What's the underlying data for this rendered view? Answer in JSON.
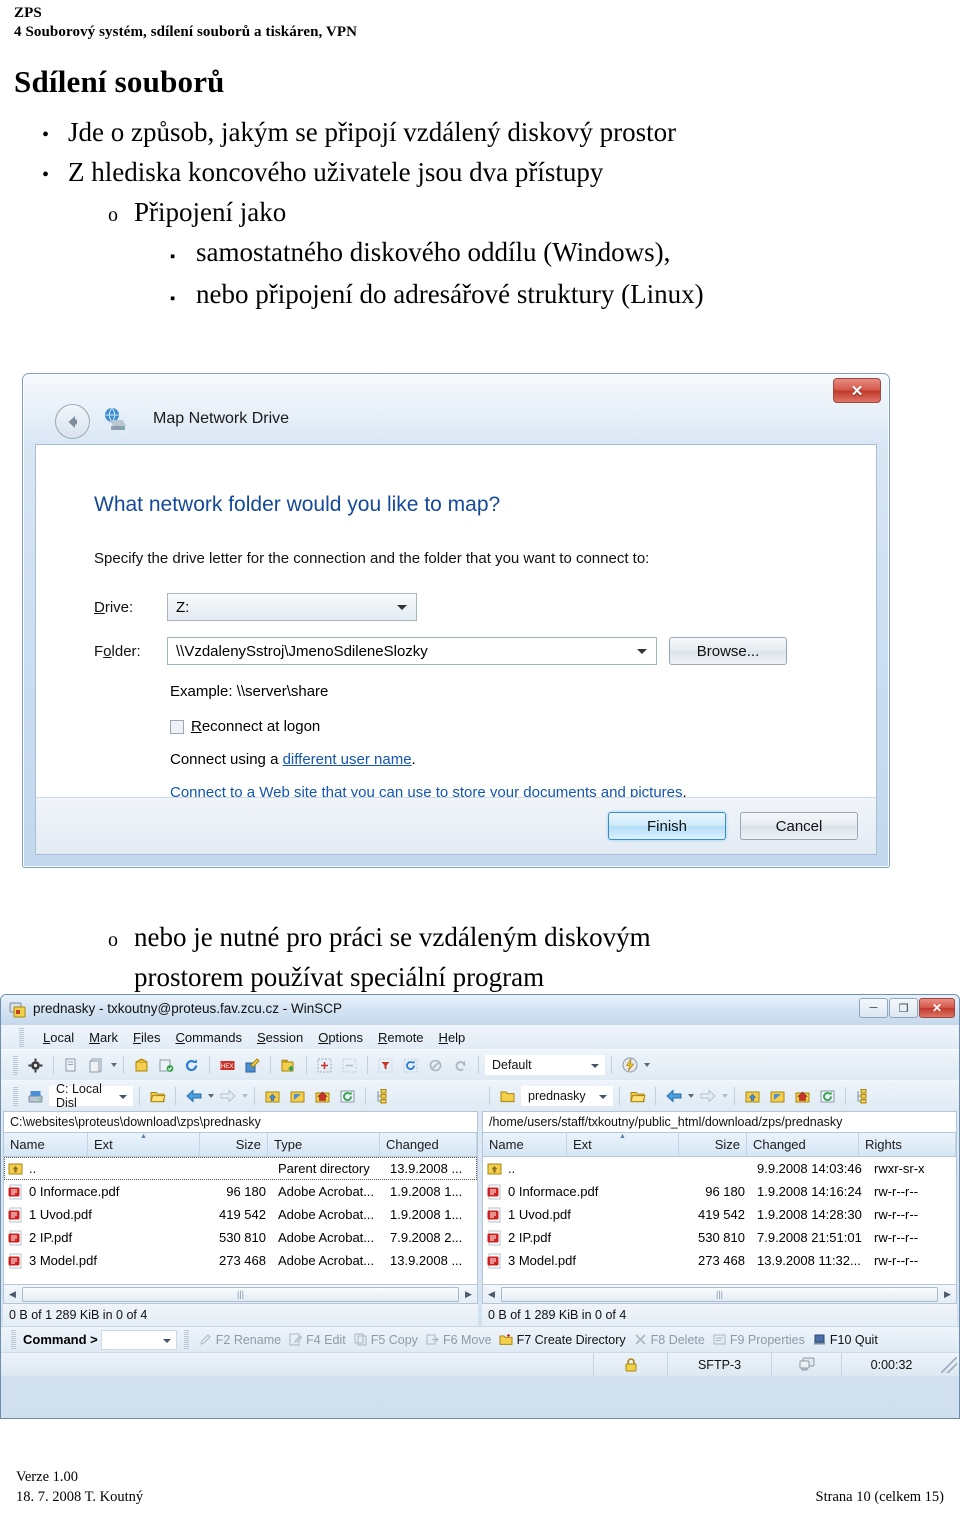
{
  "doc": {
    "header_line1": "ZPS",
    "header_line2": "4 Souborový systém, sdílení souborů a tiskáren, VPN",
    "title": "Sdílení souborů",
    "footer_left_line1": "Verze 1.00",
    "footer_left_line2": "18. 7. 2008 T. Koutný",
    "footer_right": "Strana 10 (celkem 15)"
  },
  "bullets": [
    {
      "level": 1,
      "mark": "•",
      "text": "Jde o způsob, jakým se připojí vzdálený diskový prostor"
    },
    {
      "level": 1,
      "mark": "•",
      "text": "Z hlediska koncového uživatele jsou dva přístupy"
    },
    {
      "level": 2,
      "mark": "o",
      "text": "Připojení jako"
    },
    {
      "level": 3,
      "mark": "▪",
      "text": "samostatného diskového oddílu (Windows),"
    },
    {
      "level": 3,
      "mark": "▪",
      "text": "nebo připojení do adresářové struktury (Linux)"
    }
  ],
  "bullets_after": [
    {
      "level": 2,
      "mark": "o",
      "text": "nebo je nutné pro práci se vzdáleným diskovým"
    },
    {
      "level": 2,
      "mark": "",
      "text": "prostorem používat speciální program"
    }
  ],
  "map_network_drive": {
    "window_title": "Map Network Drive",
    "close_label": "✕",
    "heading": "What network folder would you like to map?",
    "subtext": "Specify the drive letter for the connection and the folder that you want to connect to:",
    "drive_label": "Drive:",
    "drive_value": "Z:",
    "folder_label": "Folder:",
    "folder_value": "\\\\VzdalenySstroj\\JmenoSdileneSlozky",
    "browse_label": "Browse...",
    "example_text": "Example: \\\\server\\share",
    "reconnect_label": "Reconnect at logon",
    "reconnect_checked": false,
    "connect_prefix": "Connect using a ",
    "connect_link": "different user name",
    "connect_suffix": ".",
    "website_link": "Connect to a Web site that you can use to store your documents and pictures",
    "website_suffix": ".",
    "finish_label": "Finish",
    "cancel_label": "Cancel"
  },
  "winscp": {
    "title": "prednasky - txkoutny@proteus.fav.zcu.cz - WinSCP",
    "window_buttons": {
      "minimize": "─",
      "maximize": "❐",
      "close": "✕"
    },
    "menu": [
      "Local",
      "Mark",
      "Files",
      "Commands",
      "Session",
      "Options",
      "Remote",
      "Help"
    ],
    "toolbar_session_value": "Default",
    "local": {
      "drive_value": "C: Local Disl",
      "path": "C:\\websites\\proteus\\download\\zps\\prednasky",
      "columns": [
        "Name",
        "Ext",
        "Size",
        "Type",
        "Changed"
      ],
      "sorted_column": "Ext",
      "rows": [
        {
          "name": "..",
          "ext": "",
          "size": "",
          "type": "Parent directory",
          "changed": "13.9.2008  ...",
          "icon": "folder-up-icon"
        },
        {
          "name": "0 Informace.pdf",
          "ext": "",
          "size": "96 180",
          "type": "Adobe Acrobat...",
          "changed": "1.9.2008  1...",
          "icon": "pdf-icon"
        },
        {
          "name": "1 Uvod.pdf",
          "ext": "",
          "size": "419 542",
          "type": "Adobe Acrobat...",
          "changed": "1.9.2008  1...",
          "icon": "pdf-icon"
        },
        {
          "name": "2 IP.pdf",
          "ext": "",
          "size": "530 810",
          "type": "Adobe Acrobat...",
          "changed": "7.9.2008  2...",
          "icon": "pdf-icon"
        },
        {
          "name": "3 Model.pdf",
          "ext": "",
          "size": "273 468",
          "type": "Adobe Acrobat...",
          "changed": "13.9.2008  ...",
          "icon": "pdf-icon"
        }
      ],
      "status": "0 B of 1 289 KiB in 0 of 4"
    },
    "remote": {
      "dir_value": "prednasky",
      "path": "/home/users/staff/txkoutny/public_html/download/zps/prednasky",
      "columns": [
        "Name",
        "Ext",
        "Size",
        "Changed",
        "Rights"
      ],
      "sorted_column": "Ext",
      "rows": [
        {
          "name": "..",
          "ext": "",
          "size": "",
          "changed": "9.9.2008 14:03:46",
          "rights": "rwxr-sr-x",
          "icon": "folder-up-icon"
        },
        {
          "name": "0 Informace.pdf",
          "ext": "",
          "size": "96 180",
          "changed": "1.9.2008 14:16:24",
          "rights": "rw-r--r--",
          "icon": "pdf-icon"
        },
        {
          "name": "1 Uvod.pdf",
          "ext": "",
          "size": "419 542",
          "changed": "1.9.2008 14:28:30",
          "rights": "rw-r--r--",
          "icon": "pdf-icon"
        },
        {
          "name": "2 IP.pdf",
          "ext": "",
          "size": "530 810",
          "changed": "7.9.2008 21:51:01",
          "rights": "rw-r--r--",
          "icon": "pdf-icon"
        },
        {
          "name": "3 Model.pdf",
          "ext": "",
          "size": "273 468",
          "changed": "13.9.2008 11:32...",
          "rights": "rw-r--r--",
          "icon": "pdf-icon"
        }
      ],
      "status": "0 B of 1 289 KiB in 0 of 4"
    },
    "command_label": "Command >",
    "command_value": "",
    "fkeys": [
      {
        "label": "F2 Rename",
        "enabled": false
      },
      {
        "label": "F4 Edit",
        "enabled": false
      },
      {
        "label": "F5 Copy",
        "enabled": false
      },
      {
        "label": "F6 Move",
        "enabled": false
      },
      {
        "label": "F7 Create Directory",
        "enabled": true
      },
      {
        "label": "F8 Delete",
        "enabled": false
      },
      {
        "label": "F9 Properties",
        "enabled": false
      },
      {
        "label": "F10 Quit",
        "enabled": true
      }
    ],
    "statusbar": {
      "protocol": "SFTP-3",
      "time": "0:00:32"
    }
  },
  "colors": {
    "link": "#1356b3",
    "dialog_heading": "#15499b",
    "close_red": "#c0392b",
    "pdf_red": "#cc2222"
  }
}
